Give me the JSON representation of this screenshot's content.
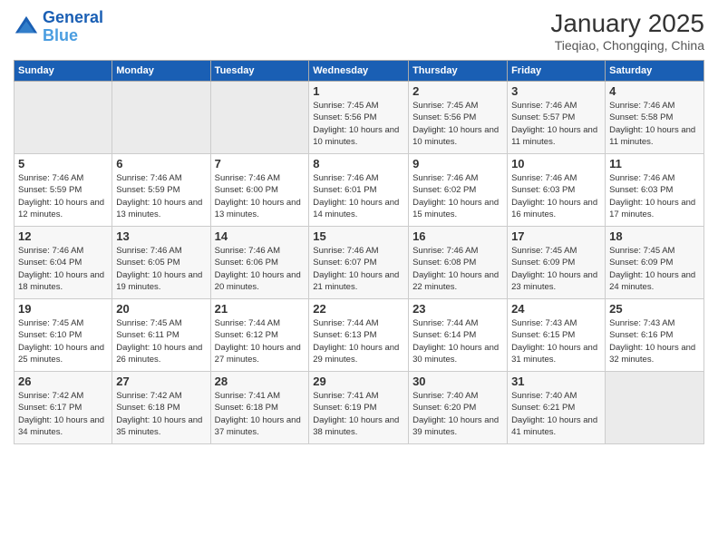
{
  "logo": {
    "line1": "General",
    "line2": "Blue"
  },
  "title": "January 2025",
  "subtitle": "Tieqiao, Chongqing, China",
  "weekdays": [
    "Sunday",
    "Monday",
    "Tuesday",
    "Wednesday",
    "Thursday",
    "Friday",
    "Saturday"
  ],
  "weeks": [
    [
      {
        "day": "",
        "info": ""
      },
      {
        "day": "",
        "info": ""
      },
      {
        "day": "",
        "info": ""
      },
      {
        "day": "1",
        "info": "Sunrise: 7:45 AM\nSunset: 5:56 PM\nDaylight: 10 hours\nand 10 minutes."
      },
      {
        "day": "2",
        "info": "Sunrise: 7:45 AM\nSunset: 5:56 PM\nDaylight: 10 hours\nand 10 minutes."
      },
      {
        "day": "3",
        "info": "Sunrise: 7:46 AM\nSunset: 5:57 PM\nDaylight: 10 hours\nand 11 minutes."
      },
      {
        "day": "4",
        "info": "Sunrise: 7:46 AM\nSunset: 5:58 PM\nDaylight: 10 hours\nand 11 minutes."
      }
    ],
    [
      {
        "day": "5",
        "info": "Sunrise: 7:46 AM\nSunset: 5:59 PM\nDaylight: 10 hours\nand 12 minutes."
      },
      {
        "day": "6",
        "info": "Sunrise: 7:46 AM\nSunset: 5:59 PM\nDaylight: 10 hours\nand 13 minutes."
      },
      {
        "day": "7",
        "info": "Sunrise: 7:46 AM\nSunset: 6:00 PM\nDaylight: 10 hours\nand 13 minutes."
      },
      {
        "day": "8",
        "info": "Sunrise: 7:46 AM\nSunset: 6:01 PM\nDaylight: 10 hours\nand 14 minutes."
      },
      {
        "day": "9",
        "info": "Sunrise: 7:46 AM\nSunset: 6:02 PM\nDaylight: 10 hours\nand 15 minutes."
      },
      {
        "day": "10",
        "info": "Sunrise: 7:46 AM\nSunset: 6:03 PM\nDaylight: 10 hours\nand 16 minutes."
      },
      {
        "day": "11",
        "info": "Sunrise: 7:46 AM\nSunset: 6:03 PM\nDaylight: 10 hours\nand 17 minutes."
      }
    ],
    [
      {
        "day": "12",
        "info": "Sunrise: 7:46 AM\nSunset: 6:04 PM\nDaylight: 10 hours\nand 18 minutes."
      },
      {
        "day": "13",
        "info": "Sunrise: 7:46 AM\nSunset: 6:05 PM\nDaylight: 10 hours\nand 19 minutes."
      },
      {
        "day": "14",
        "info": "Sunrise: 7:46 AM\nSunset: 6:06 PM\nDaylight: 10 hours\nand 20 minutes."
      },
      {
        "day": "15",
        "info": "Sunrise: 7:46 AM\nSunset: 6:07 PM\nDaylight: 10 hours\nand 21 minutes."
      },
      {
        "day": "16",
        "info": "Sunrise: 7:46 AM\nSunset: 6:08 PM\nDaylight: 10 hours\nand 22 minutes."
      },
      {
        "day": "17",
        "info": "Sunrise: 7:45 AM\nSunset: 6:09 PM\nDaylight: 10 hours\nand 23 minutes."
      },
      {
        "day": "18",
        "info": "Sunrise: 7:45 AM\nSunset: 6:09 PM\nDaylight: 10 hours\nand 24 minutes."
      }
    ],
    [
      {
        "day": "19",
        "info": "Sunrise: 7:45 AM\nSunset: 6:10 PM\nDaylight: 10 hours\nand 25 minutes."
      },
      {
        "day": "20",
        "info": "Sunrise: 7:45 AM\nSunset: 6:11 PM\nDaylight: 10 hours\nand 26 minutes."
      },
      {
        "day": "21",
        "info": "Sunrise: 7:44 AM\nSunset: 6:12 PM\nDaylight: 10 hours\nand 27 minutes."
      },
      {
        "day": "22",
        "info": "Sunrise: 7:44 AM\nSunset: 6:13 PM\nDaylight: 10 hours\nand 29 minutes."
      },
      {
        "day": "23",
        "info": "Sunrise: 7:44 AM\nSunset: 6:14 PM\nDaylight: 10 hours\nand 30 minutes."
      },
      {
        "day": "24",
        "info": "Sunrise: 7:43 AM\nSunset: 6:15 PM\nDaylight: 10 hours\nand 31 minutes."
      },
      {
        "day": "25",
        "info": "Sunrise: 7:43 AM\nSunset: 6:16 PM\nDaylight: 10 hours\nand 32 minutes."
      }
    ],
    [
      {
        "day": "26",
        "info": "Sunrise: 7:42 AM\nSunset: 6:17 PM\nDaylight: 10 hours\nand 34 minutes."
      },
      {
        "day": "27",
        "info": "Sunrise: 7:42 AM\nSunset: 6:18 PM\nDaylight: 10 hours\nand 35 minutes."
      },
      {
        "day": "28",
        "info": "Sunrise: 7:41 AM\nSunset: 6:18 PM\nDaylight: 10 hours\nand 37 minutes."
      },
      {
        "day": "29",
        "info": "Sunrise: 7:41 AM\nSunset: 6:19 PM\nDaylight: 10 hours\nand 38 minutes."
      },
      {
        "day": "30",
        "info": "Sunrise: 7:40 AM\nSunset: 6:20 PM\nDaylight: 10 hours\nand 39 minutes."
      },
      {
        "day": "31",
        "info": "Sunrise: 7:40 AM\nSunset: 6:21 PM\nDaylight: 10 hours\nand 41 minutes."
      },
      {
        "day": "",
        "info": ""
      }
    ]
  ]
}
